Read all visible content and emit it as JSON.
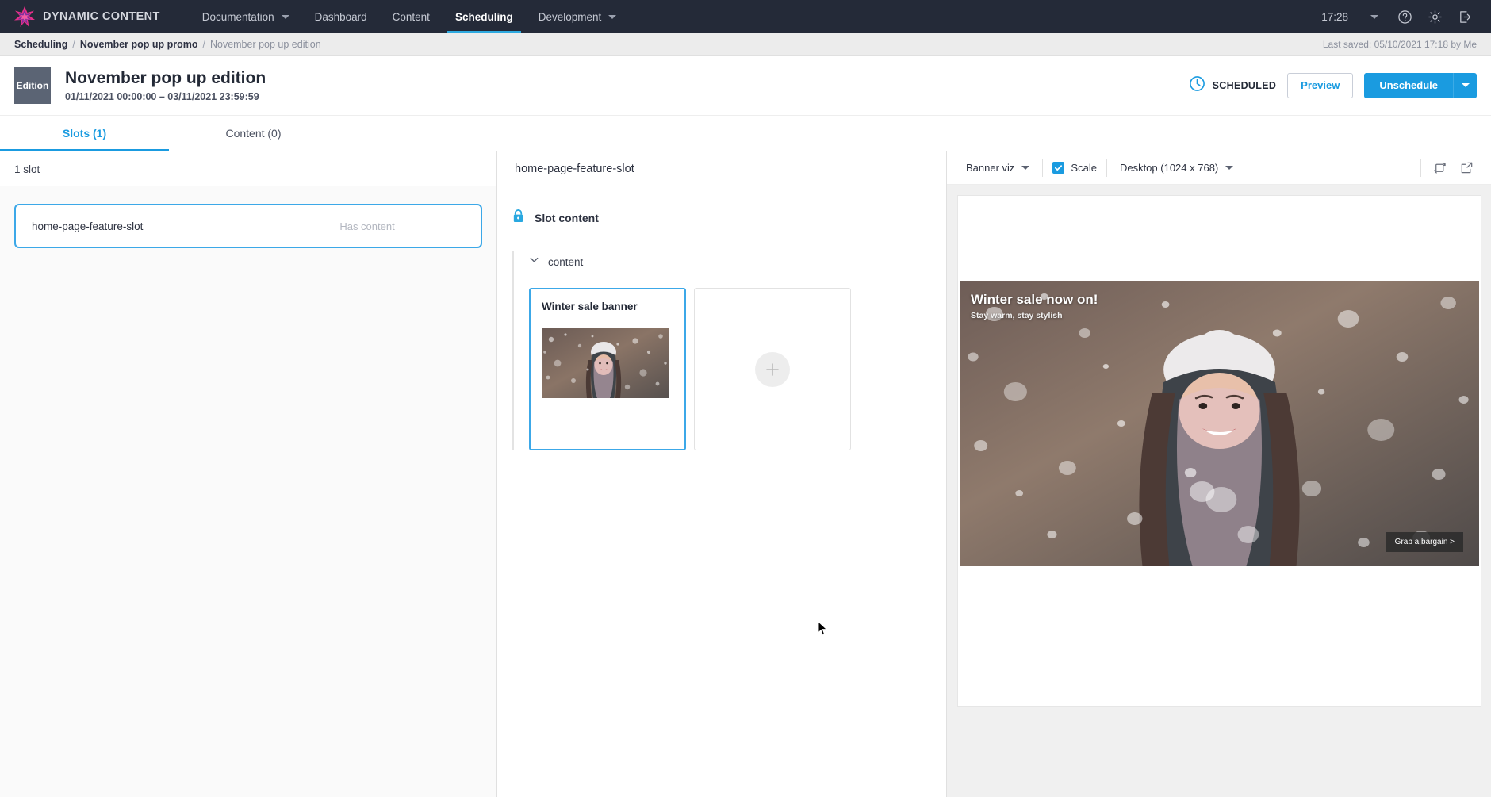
{
  "topnav": {
    "brand": "DYNAMIC CONTENT",
    "items": [
      {
        "label": "Documentation",
        "has_caret": true,
        "active": false
      },
      {
        "label": "Dashboard",
        "has_caret": false,
        "active": false
      },
      {
        "label": "Content",
        "has_caret": false,
        "active": false
      },
      {
        "label": "Scheduling",
        "has_caret": false,
        "active": true
      },
      {
        "label": "Development",
        "has_caret": true,
        "active": false
      }
    ],
    "time": "17:28",
    "icons": [
      "help-icon",
      "gear-icon",
      "logout-icon"
    ]
  },
  "breadcrumb": {
    "root": "Scheduling",
    "parent": "November pop up promo",
    "current": "November pop up edition",
    "separator": "/",
    "last_saved": "Last saved: 05/10/2021 17:18 by Me"
  },
  "header": {
    "badge": "Edition",
    "title": "November pop up edition",
    "date_range": "01/11/2021 00:00:00  –  03/11/2021 23:59:59",
    "status": "SCHEDULED",
    "preview_label": "Preview",
    "unschedule_label": "Unschedule"
  },
  "tabs": [
    {
      "label": "Slots (1)",
      "active": true
    },
    {
      "label": "Content (0)",
      "active": false
    }
  ],
  "left": {
    "count_label": "1 slot",
    "slots": [
      {
        "name": "home-page-feature-slot",
        "status": "Has content"
      }
    ]
  },
  "center": {
    "title": "home-page-feature-slot",
    "icons": [
      "copy-icon",
      "list-check-icon",
      "eye-icon",
      "info-icon"
    ],
    "slot_content_label": "Slot content",
    "group_label": "content",
    "cards": [
      {
        "title": "Winter sale banner"
      }
    ]
  },
  "preview": {
    "visualization": "Banner viz",
    "scale_label": "Scale",
    "scale_checked": true,
    "device": "Desktop (1024 x 768)",
    "icons": [
      "rotate-icon",
      "open-external-icon"
    ],
    "banner": {
      "title": "Winter sale now on!",
      "subtitle": "Stay warm, stay stylish",
      "cta": "Grab a bargain >"
    }
  },
  "colors": {
    "nav_bg": "#242a38",
    "accent": "#1a9be0",
    "brand_pink": "#e8308a",
    "badge_gray": "#5b6474"
  }
}
